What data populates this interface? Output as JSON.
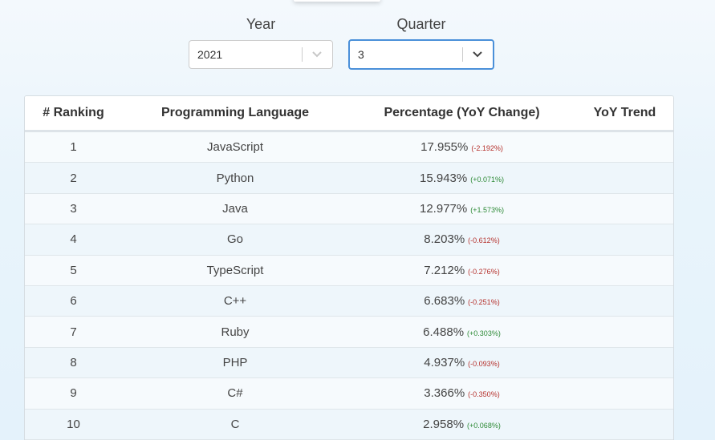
{
  "filters": {
    "year": {
      "label": "Year",
      "value": "2021"
    },
    "quarter": {
      "label": "Quarter",
      "value": "3"
    }
  },
  "table": {
    "headers": [
      "# Ranking",
      "Programming Language",
      "Percentage (YoY Change)",
      "YoY Trend"
    ],
    "rows": [
      {
        "rank": "1",
        "language": "JavaScript",
        "percentage": "17.955%",
        "change": "(-2.192%)",
        "direction": "negative"
      },
      {
        "rank": "2",
        "language": "Python",
        "percentage": "15.943%",
        "change": "(+0.071%)",
        "direction": "positive"
      },
      {
        "rank": "3",
        "language": "Java",
        "percentage": "12.977%",
        "change": "(+1.573%)",
        "direction": "positive"
      },
      {
        "rank": "4",
        "language": "Go",
        "percentage": "8.203%",
        "change": "(-0.612%)",
        "direction": "negative"
      },
      {
        "rank": "5",
        "language": "TypeScript",
        "percentage": "7.212%",
        "change": "(-0.276%)",
        "direction": "negative"
      },
      {
        "rank": "6",
        "language": "C++",
        "percentage": "6.683%",
        "change": "(-0.251%)",
        "direction": "negative"
      },
      {
        "rank": "7",
        "language": "Ruby",
        "percentage": "6.488%",
        "change": "(+0.303%)",
        "direction": "positive"
      },
      {
        "rank": "8",
        "language": "PHP",
        "percentage": "4.937%",
        "change": "(-0.093%)",
        "direction": "negative"
      },
      {
        "rank": "9",
        "language": "C#",
        "percentage": "3.366%",
        "change": "(-0.350%)",
        "direction": "negative"
      },
      {
        "rank": "10",
        "language": "C",
        "percentage": "2.958%",
        "change": "(+0.068%)",
        "direction": "positive"
      }
    ]
  },
  "colors": {
    "negative_change": "#b5302b",
    "positive_change": "#2d8a36",
    "focus_border": "#4a90d9"
  },
  "icons": {
    "select_arrow": "chevron-down-icon"
  }
}
